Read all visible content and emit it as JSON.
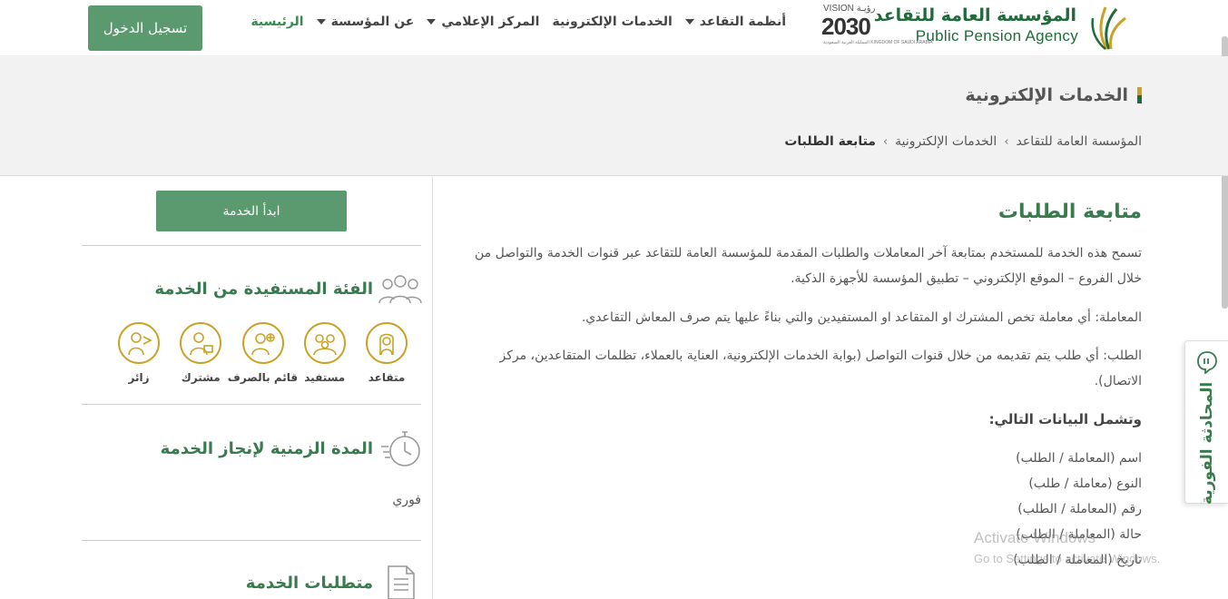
{
  "header": {
    "logo_ar": "المؤسسة العامة للتقاعد",
    "logo_en": "Public Pension Agency",
    "vision_top": "VISION رؤيـة",
    "vision_year": "2030",
    "vision_sub": "المملكة العربية السعودية KINGDOM OF SAUDI ARABIA",
    "nav": [
      {
        "label": "الرئيسية",
        "dropdown": false,
        "active": true
      },
      {
        "label": "عن المؤسسة",
        "dropdown": true,
        "active": false
      },
      {
        "label": "المركز الإعلامي",
        "dropdown": true,
        "active": false
      },
      {
        "label": "الخدمات الإلكترونية",
        "dropdown": false,
        "active": false
      },
      {
        "label": "أنظمة التقاعد",
        "dropdown": true,
        "active": false
      }
    ],
    "login_label": "تسجيل الدخول"
  },
  "band": {
    "title": "الخدمات الإلكترونية",
    "breadcrumb": [
      "المؤسسة العامة للتقاعد",
      "الخدمات الإلكترونية",
      "متابعة الطلبات"
    ],
    "separator": "›"
  },
  "main": {
    "title": "متابعة الطلبات",
    "intro": "تسمح هذه الخدمة للمستخدم بمتابعة آخر المعاملات والطلبات المقدمة للمؤسسة العامة للتقاعد عبر قنوات الخدمة والتواصل من خلال الفروع – الموقع الإلكتروني – تطبيق المؤسسة للأجهزة الذكية.",
    "transaction": "المعاملة: أي معاملة تخص المشترك او المتقاعد او المستفيدين والتي بناءً عليها يتم صرف المعاش التقاعدي.",
    "request": "الطلب: أي طلب يتم تقديمه من خلال قنوات التواصل (بوابة الخدمات الإلكترونية، العناية بالعملاء، تظلمات المتقاعدين، مركز الاتصال).",
    "includes_heading": "وتشمل البيانات التالي:",
    "includes": [
      "اسم (المعاملة / الطلب)",
      "النوع (معاملة / طلب)",
      "رقم (المعاملة / الطلب)",
      "حالة (المعاملة / الطلب)",
      "تاريخ (المعاملة / الطلب)"
    ]
  },
  "sidebar": {
    "start_label": "ابدأ الخدمة",
    "beneficiaries_heading": "الفئة المستفيدة من الخدمة",
    "categories": [
      {
        "label": "متقاعد",
        "icon": "retiree-icon"
      },
      {
        "label": "مستفيد",
        "icon": "beneficiary-icon"
      },
      {
        "label": "قائم بالصرف",
        "icon": "disburser-icon"
      },
      {
        "label": "مشترك",
        "icon": "subscriber-icon"
      },
      {
        "label": "زائر",
        "icon": "visitor-icon"
      }
    ],
    "duration_heading": "المدة الزمنية لإنجاز الخدمة",
    "duration_value": "فوري",
    "requirements_heading": "متطلبات الخدمة"
  },
  "chat": {
    "label": "المحادثة الفورية"
  },
  "watermark": {
    "line1": "Activate Windows",
    "line2": "Go to Settings to activate Windows."
  },
  "colors": {
    "brand_green": "#3a7a4f",
    "button_green": "#5a9a6e",
    "gold": "#c9a227"
  }
}
